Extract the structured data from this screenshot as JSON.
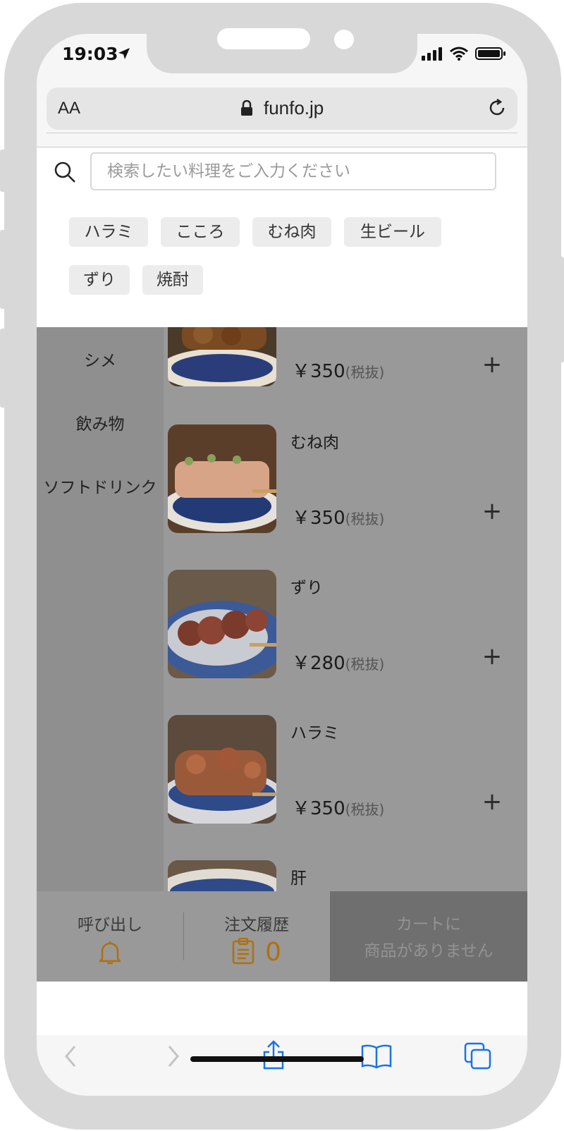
{
  "status_bar": {
    "time": "19:03"
  },
  "browser": {
    "text_size_label": "AA",
    "url": "funfo.jp"
  },
  "search": {
    "placeholder": "検索したい料理をご入力ください"
  },
  "tags": [
    "ハラミ",
    "こころ",
    "むね肉",
    "生ビール",
    "ずり",
    "焼酎"
  ],
  "categories": [
    "シメ",
    "飲み物",
    "ソフトドリンク"
  ],
  "menu_items": [
    {
      "name": "",
      "price": "￥350",
      "tax": "(税抜)"
    },
    {
      "name": "むね肉",
      "price": "￥350",
      "tax": "(税抜)"
    },
    {
      "name": "ずり",
      "price": "￥280",
      "tax": "(税抜)"
    },
    {
      "name": "ハラミ",
      "price": "￥350",
      "tax": "(税抜)"
    },
    {
      "name": "肝",
      "price": "",
      "tax": ""
    }
  ],
  "bottom_bar": {
    "call_label": "呼び出し",
    "history_label": "注文履歴",
    "history_count": "0",
    "cart_line1": "カートに",
    "cart_line2": "商品がありません"
  },
  "colors": {
    "accent": "#b0700c",
    "toolbar_blue": "#1a73e8"
  }
}
